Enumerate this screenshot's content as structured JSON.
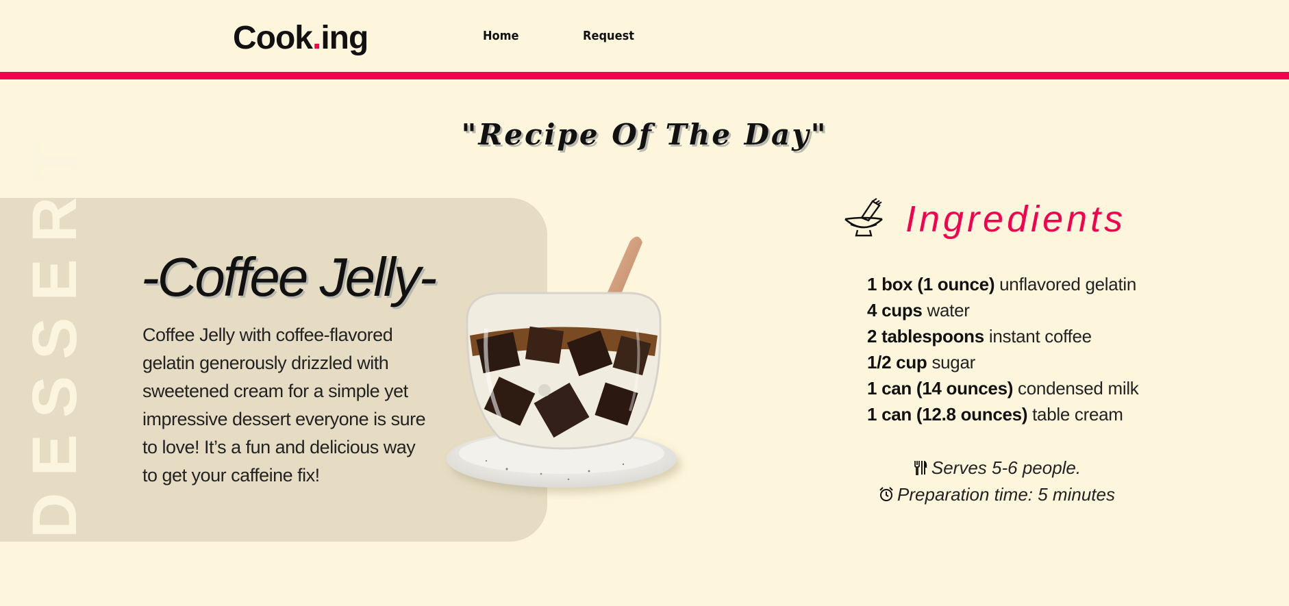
{
  "header": {
    "logo": {
      "part1": "Cook",
      "dot": ".",
      "part2": "ing"
    },
    "nav": [
      {
        "label": "Home"
      },
      {
        "label": "Request"
      }
    ],
    "accent_color": "#f5004e"
  },
  "main": {
    "section_title": "\"Recipe Of The Day\"",
    "category_label": "DESSERT",
    "dish_title": "-Coffee Jelly-",
    "dish_description": "Coffee Jelly with coffee-flavored gelatin generously drizzled with sweetened cream for a simple yet impressive dessert everyone is sure to love! It’s a fun and delicious way to get your caffeine fix!",
    "dish_image": "coffee-jelly-glass-image"
  },
  "ingredients": {
    "title": "Ingredients",
    "icon": "mixing-bowl-icon",
    "items": [
      {
        "qty": "1 box (1 ounce)",
        "item": "unflavored gelatin"
      },
      {
        "qty": "4 cups",
        "item": "water"
      },
      {
        "qty": "2 tablespoons",
        "item": "instant coffee"
      },
      {
        "qty": "1/2 cup",
        "item": "sugar"
      },
      {
        "qty": "1 can (14 ounces)",
        "item": "condensed milk"
      },
      {
        "qty": "1 can (12.8 ounces)",
        "item": "table cream"
      }
    ],
    "serves": "Serves 5-6 people.",
    "serves_icon": "utensils-icon",
    "prep_time": "Preparation time: 5 minutes",
    "prep_icon": "alarm-clock-icon"
  }
}
